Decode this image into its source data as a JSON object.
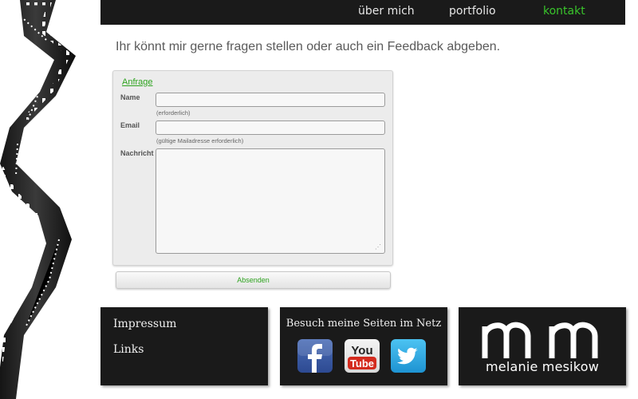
{
  "nav": {
    "items": [
      {
        "label": "über mich",
        "active": false
      },
      {
        "label": "portfolio",
        "active": false
      },
      {
        "label": "kontakt",
        "active": true
      }
    ]
  },
  "intro": "Ihr könnt mir gerne fragen stellen oder auch ein Feedback abgeben.",
  "form": {
    "legend": "Anfrage",
    "name_label": "Name",
    "name_hint": "(erforderlich)",
    "email_label": "Email",
    "email_hint": "(gültige Mailadresse erforderlich)",
    "message_label": "Nachricht",
    "submit_label": "Absenden"
  },
  "footer": {
    "links": [
      "Impressum",
      "Links"
    ],
    "social_title": "Besuch meine Seiten im Netz",
    "social_icons": [
      "facebook-icon",
      "youtube-icon",
      "twitter-icon"
    ],
    "logo_monogram": "mm",
    "logo_name": "melanie mesikow"
  },
  "colors": {
    "accent": "#39c42b",
    "nav_bg": "#1a1a1a",
    "panel_bg": "#ececec"
  }
}
